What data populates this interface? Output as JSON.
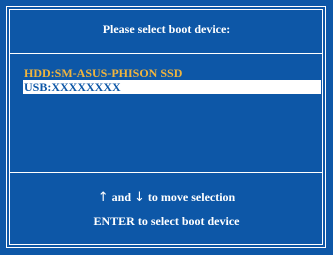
{
  "header": {
    "title": "Please select boot device:"
  },
  "devices": [
    {
      "label": "HDD:SM-ASUS-PHISON SSD",
      "selected": false
    },
    {
      "label": "USB:XXXXXXXX",
      "selected": true
    }
  ],
  "help": {
    "up_arrow": "↑",
    "and_word": "and",
    "down_arrow": "↓",
    "move_text": "to move selection",
    "enter_text": "ENTER to select boot device"
  },
  "colors": {
    "background": "#0d57a7",
    "frame": "#ffffff",
    "device_text": "#f0b53e",
    "selected_bg": "#ffffff",
    "selected_text": "#0d57a7"
  }
}
